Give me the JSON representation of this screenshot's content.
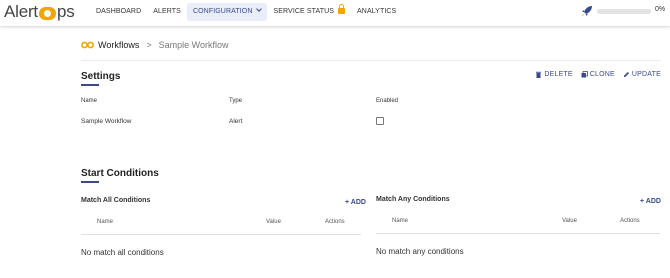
{
  "header": {
    "logo_left": "Alert",
    "logo_right": "ps",
    "nav": [
      {
        "label": "DASHBOARD"
      },
      {
        "label": "ALERTS"
      },
      {
        "label": "CONFIGURATION"
      },
      {
        "label": "SERVICE STATUS"
      },
      {
        "label": "ANALYTICS"
      }
    ],
    "progress_text": "0%",
    "progress_value": 0
  },
  "breadcrumb": {
    "main": "Workflows",
    "separator": ">",
    "current": "Sample Workflow"
  },
  "settings": {
    "title": "Settings",
    "actions": {
      "delete": "DELETE",
      "clone": "CLONE",
      "update": "UPDATE"
    },
    "columns": {
      "name": "Name",
      "type": "Type",
      "enabled": "Enabled"
    },
    "row": {
      "name": "Sample Workflow",
      "type": "Alert",
      "enabled": false
    }
  },
  "start_conditions": {
    "title": "Start Conditions",
    "match_all": {
      "title": "Match All Conditions",
      "add_label": "+ ADD",
      "columns": {
        "name": "Name",
        "value": "Value",
        "actions": "Actions"
      },
      "empty": "No match all conditions"
    },
    "match_any": {
      "title": "Match Any Conditions",
      "add_label": "+ ADD",
      "columns": {
        "name": "Name",
        "value": "Value",
        "actions": "Actions"
      },
      "empty": "No match any conditions"
    }
  },
  "colors": {
    "accent": "#3a4a8c",
    "brand": "#f0a500"
  }
}
